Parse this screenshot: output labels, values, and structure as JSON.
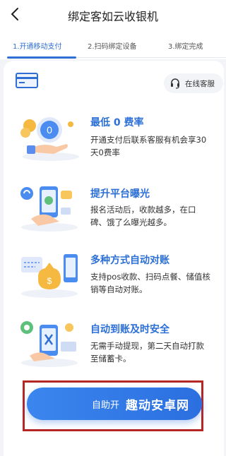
{
  "header": {
    "title": "绑定客如云收银机",
    "back_icon": "chevron-left-icon"
  },
  "steps": [
    {
      "label": "1.开通移动支付",
      "active": true
    },
    {
      "label": "2.扫码绑定设备",
      "active": false
    },
    {
      "label": "3.绑定完成",
      "active": false
    }
  ],
  "top": {
    "card_icon": "credit-card-icon",
    "service_label": "在线客服",
    "service_icon": "headset-icon"
  },
  "features": [
    {
      "title": "最低 0 费率",
      "desc": "开通支付后联系客服有机会享30天0费率",
      "icon": "coin-hand-illustration"
    },
    {
      "title": "提升平台曝光",
      "desc": "报名活动后，收款越多，在口碑、饿了么曝光越多。",
      "icon": "phone-hand-illustration"
    },
    {
      "title": "多种方式自动对账",
      "desc": "支持pos收款、扫码点餐、储值核销等自动对账。",
      "icon": "moneybag-illustration"
    },
    {
      "title": "自动到账及时安全",
      "desc": "无需手动提现，第二天自动打款至储蓄卡。",
      "icon": "phone-security-illustration"
    }
  ],
  "cta": {
    "label": "自助开",
    "watermark": "趣动安卓网"
  },
  "colors": {
    "accent": "#2f6fd4",
    "button": "#2c6fe0",
    "highlight_frame": "#b52626"
  }
}
